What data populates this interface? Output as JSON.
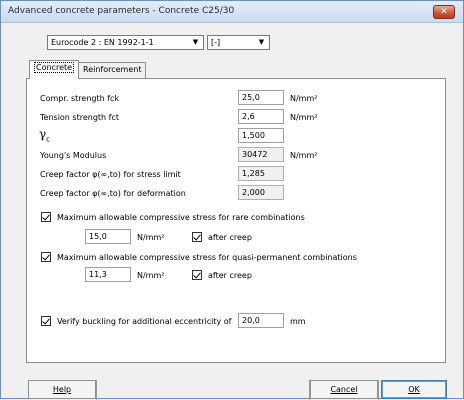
{
  "window": {
    "title": "Advanced concrete parameters - Concrete C25/30",
    "close_label": "✕"
  },
  "code_select": {
    "value": "Eurocode 2 : EN 1992-1-1",
    "arrow": "▼"
  },
  "annex_select": {
    "value": "[-]",
    "arrow": "▼"
  },
  "tabs": [
    {
      "label": "Concrete",
      "active": true
    },
    {
      "label": "Reinforcement",
      "active": false
    }
  ],
  "fields": {
    "fck": {
      "label": "Compr. strength fck",
      "value": "25,0",
      "unit": "N/mm²"
    },
    "fct": {
      "label": "Tension strength fct",
      "value": "2,6",
      "unit": "N/mm²"
    },
    "gamma_c": {
      "symbol": "γ",
      "sub": "c",
      "value": "1,500"
    },
    "young": {
      "label": "Young's Modulus",
      "value": "30472",
      "unit": "N/mm²"
    },
    "creep_stress": {
      "label": "Creep factor φ(∞,to) for stress limit",
      "value": "1,285"
    },
    "creep_def": {
      "label": "Creep factor φ(∞,to) for deformation",
      "value": "2,000"
    }
  },
  "rare": {
    "label": "Maximum allowable compressive stress for rare combinations",
    "checked": true,
    "value": "15,0",
    "unit": "N/mm²",
    "after_creep_label": "after creep",
    "after_creep_checked": true
  },
  "quasi": {
    "label": "Maximum allowable compressive stress for quasi-permanent combinations",
    "checked": true,
    "value": "11,3",
    "unit": "N/mm²",
    "after_creep_label": "after creep",
    "after_creep_checked": true
  },
  "buckling": {
    "label": "Verify buckling for additional eccentricity of",
    "checked": true,
    "value": "20,0",
    "unit": "mm"
  },
  "buttons": {
    "help": "Help",
    "cancel": "Cancel",
    "ok": "OK"
  }
}
